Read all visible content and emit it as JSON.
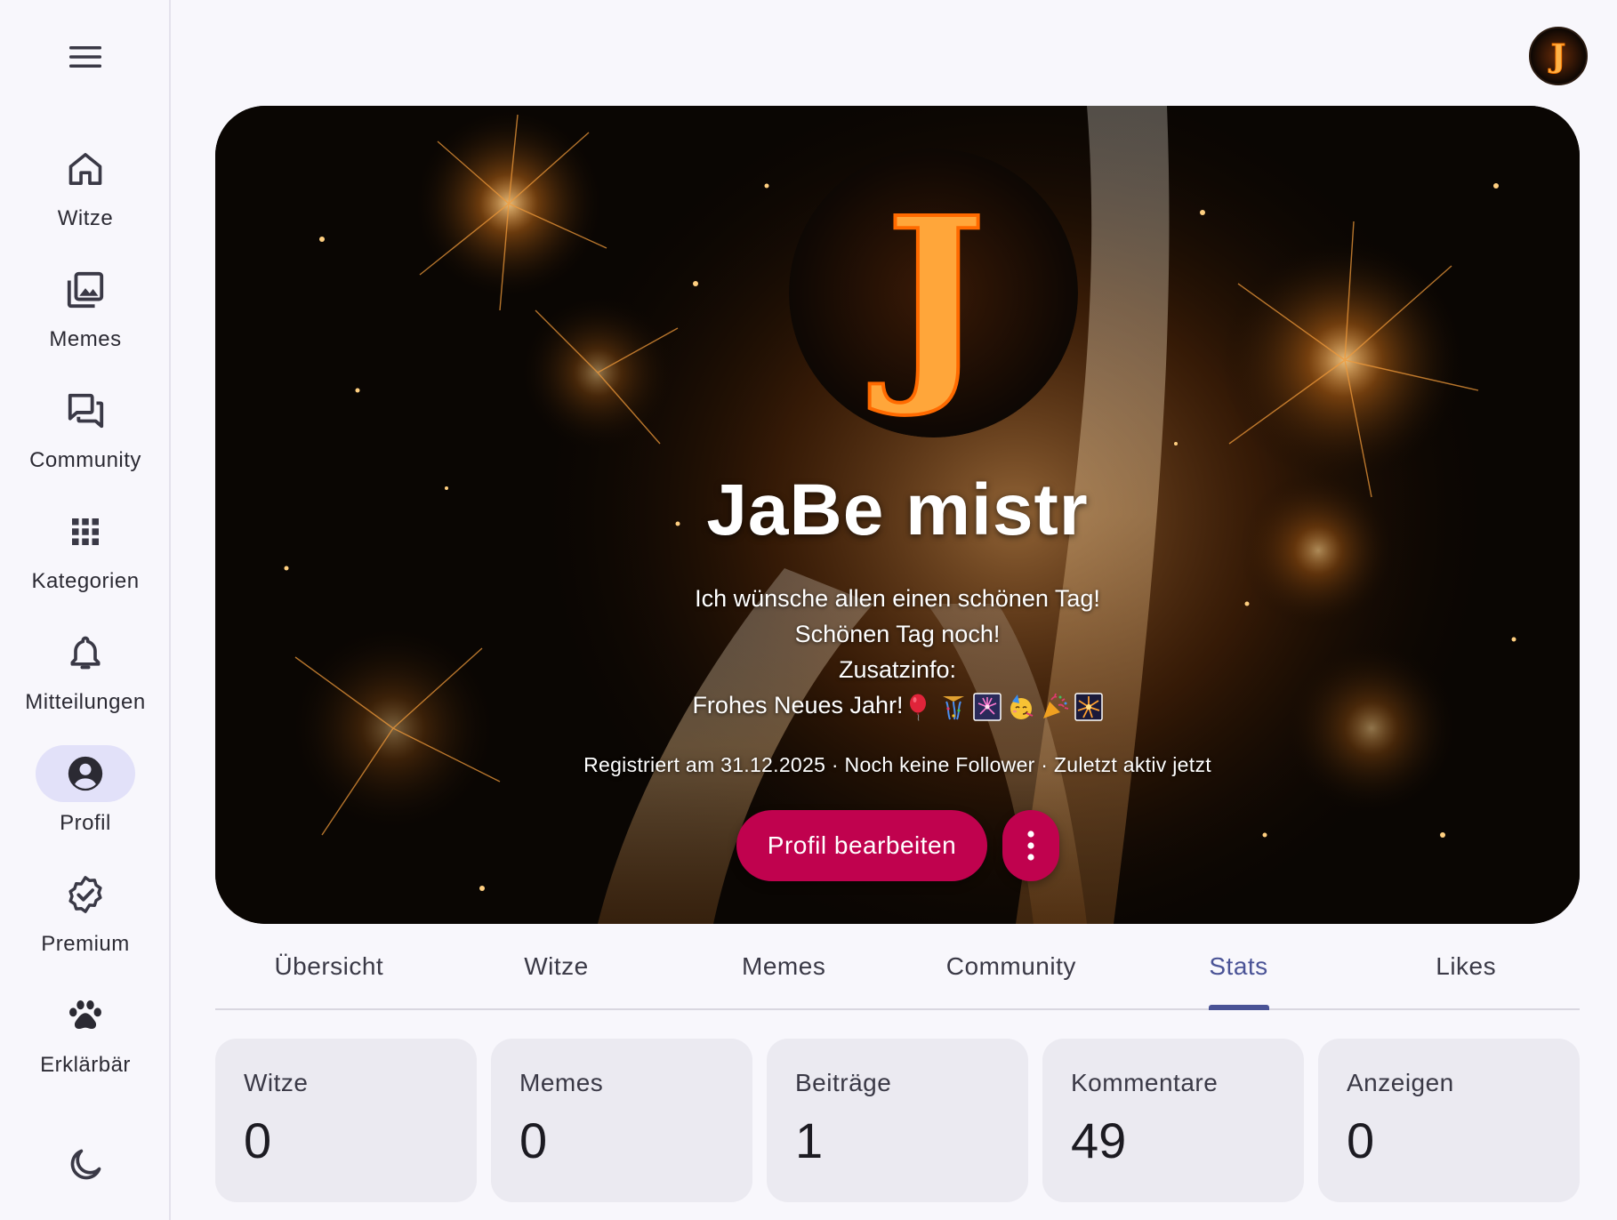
{
  "sidebar": {
    "menu_icon": "hamburger-menu-icon",
    "items": [
      {
        "label": "Witze",
        "icon": "home-icon",
        "active": false
      },
      {
        "label": "Memes",
        "icon": "image-gallery-icon",
        "active": false
      },
      {
        "label": "Community",
        "icon": "forum-icon",
        "active": false
      },
      {
        "label": "Kategorien",
        "icon": "apps-grid-icon",
        "active": false
      },
      {
        "label": "Mitteilungen",
        "icon": "bell-icon",
        "active": false
      },
      {
        "label": "Profil",
        "icon": "account-circle-icon",
        "active": true
      },
      {
        "label": "Premium",
        "icon": "verified-badge-icon",
        "active": false
      },
      {
        "label": "Erklärbär",
        "icon": "paw-icon",
        "active": false
      }
    ],
    "theme_icon": "moon-icon"
  },
  "header": {
    "avatar_letter": "J"
  },
  "profile": {
    "name": "JaBe mistr",
    "avatar_letter": "J",
    "bio_lines": [
      "Ich wünsche allen einen schönen Tag!",
      "Schönen Tag noch!",
      "Zusatzinfo:",
      "Frohes Neues Jahr!"
    ],
    "bio_emojis": [
      "balloon",
      "confetti-ball",
      "sparkler",
      "partying-face",
      "party-popper",
      "fireworks"
    ],
    "meta": "Registriert am 31.12.2025 · Noch keine Follower · Zuletzt aktiv jetzt",
    "edit_button": "Profil bearbeiten",
    "more_icon": "more-vertical-icon"
  },
  "tabs": [
    {
      "label": "Übersicht",
      "active": false
    },
    {
      "label": "Witze",
      "active": false
    },
    {
      "label": "Memes",
      "active": false
    },
    {
      "label": "Community",
      "active": false
    },
    {
      "label": "Stats",
      "active": true
    },
    {
      "label": "Likes",
      "active": false
    }
  ],
  "stats": [
    {
      "label": "Witze",
      "value": "0"
    },
    {
      "label": "Memes",
      "value": "0"
    },
    {
      "label": "Beiträge",
      "value": "1"
    },
    {
      "label": "Kommentare",
      "value": "49"
    },
    {
      "label": "Anzeigen",
      "value": "0"
    }
  ],
  "colors": {
    "primary_button": "#c0024e",
    "active_tab": "#4a5396",
    "active_nav_bg": "#e2e1f9",
    "card_bg": "#ebeaf1"
  }
}
